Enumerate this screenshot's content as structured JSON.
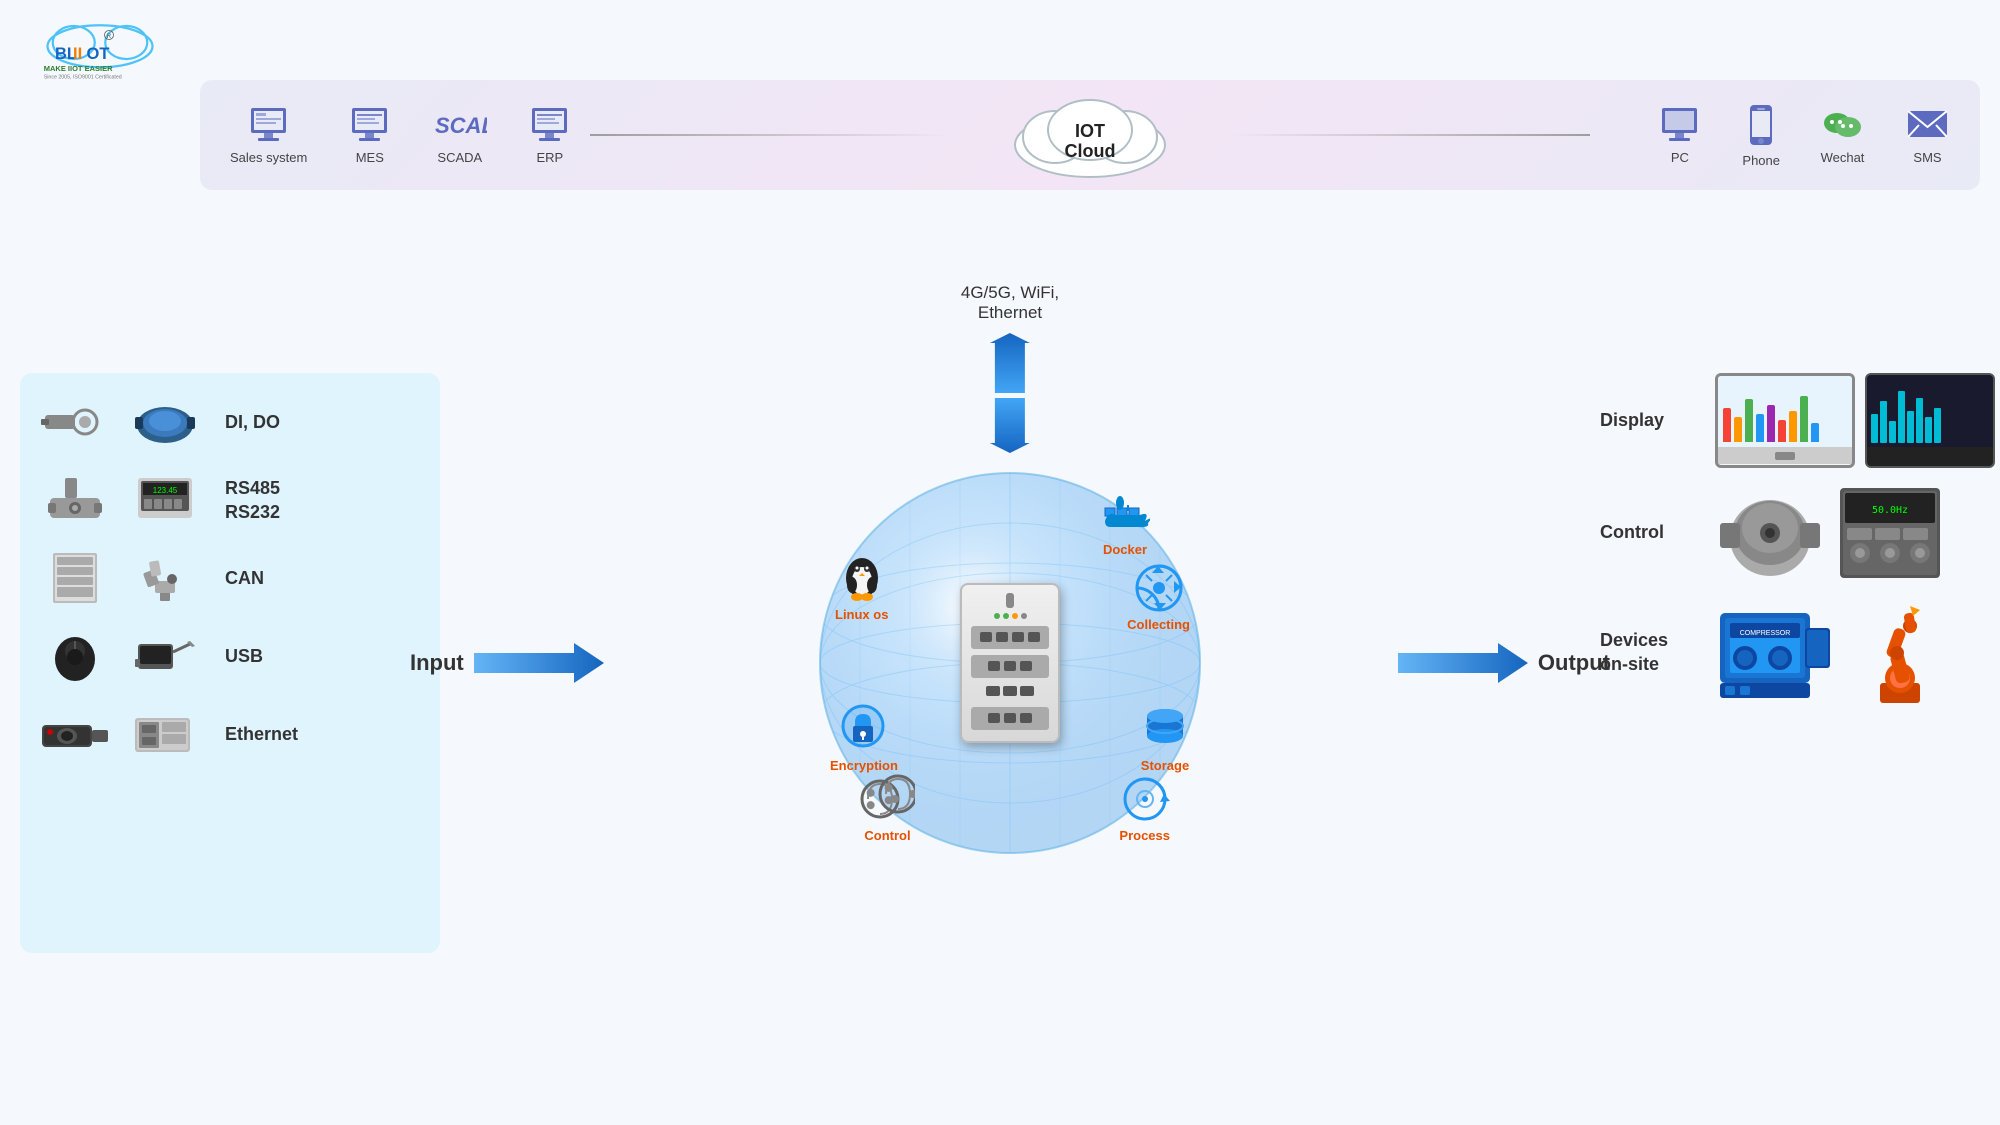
{
  "logo": {
    "brand": "BLIIOT",
    "tagline": "MAKE IIOT EASIER",
    "since": "Since 2005, ISO9001 Certificated"
  },
  "banner": {
    "left_items": [
      {
        "label": "Sales system",
        "icon": "🖥"
      },
      {
        "label": "MES",
        "icon": "🖥"
      },
      {
        "label": "SCADA",
        "icon": "SCADA"
      },
      {
        "label": "ERP",
        "icon": "🖥"
      }
    ],
    "center": {
      "line1": "IOT",
      "line2": "Cloud"
    },
    "right_items": [
      {
        "label": "PC",
        "icon": "🖥"
      },
      {
        "label": "Phone",
        "icon": "📱"
      },
      {
        "label": "Wechat",
        "icon": "💬"
      },
      {
        "label": "SMS",
        "icon": "✉"
      }
    ]
  },
  "connectivity": {
    "text1": "4G/5G, WiFi,",
    "text2": "Ethernet"
  },
  "input_label": "Input",
  "output_label": "Output",
  "devices": [
    {
      "label": "DI, DO"
    },
    {
      "label": "RS485\nRS232"
    },
    {
      "label": "CAN"
    },
    {
      "label": "USB"
    },
    {
      "label": "Ethernet"
    }
  ],
  "sphere_icons": [
    {
      "label": "Docker",
      "position": "top-right"
    },
    {
      "label": "Linux os",
      "position": "left-top"
    },
    {
      "label": "Encryption",
      "position": "left-bottom"
    },
    {
      "label": "Control",
      "position": "bottom-left"
    },
    {
      "label": "Process",
      "position": "bottom-right"
    },
    {
      "label": "Collecting",
      "position": "right-top"
    },
    {
      "label": "Storage",
      "position": "right-bottom"
    }
  ],
  "outputs": [
    {
      "label": "Display"
    },
    {
      "label": "Control"
    },
    {
      "label": "Devices\non-site"
    }
  ]
}
